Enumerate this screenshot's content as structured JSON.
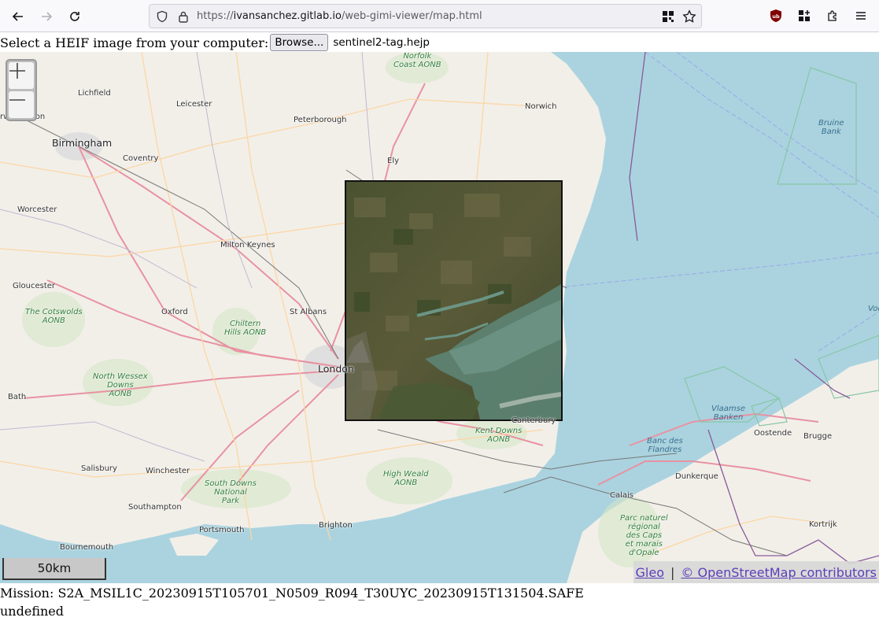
{
  "browser": {
    "url_prefix": "https://",
    "url_host": "ivansanchez.gitlab.io",
    "url_path": "/web-gimi-viewer/map.html",
    "icons": {
      "back": "back-arrow-icon",
      "forward": "forward-arrow-icon",
      "reload": "reload-icon",
      "shield": "tracking-protection-shield-icon",
      "lock": "lock-icon",
      "qr": "qr-code-icon",
      "bookmark": "star-icon",
      "ublock": "ublock-origin-icon",
      "extension_grid": "extensions-grid-icon",
      "extensions": "puzzle-icon",
      "menu": "hamburger-menu-icon"
    }
  },
  "file_input": {
    "label": "Select a HEIF image from your computer:",
    "button": "Browse...",
    "file_name": "sentinel2-tag.hejp"
  },
  "map": {
    "zoom_in": "+",
    "zoom_out": "—",
    "scale": "50km",
    "attribution": {
      "gleo": "Gleo",
      "separator": "|",
      "osm": "© OpenStreetMap contributors"
    },
    "places": [
      {
        "name": "Lichfield",
        "kind": "town"
      },
      {
        "name": "Leicester",
        "kind": "town"
      },
      {
        "name": "Peterborough",
        "kind": "town"
      },
      {
        "name": "Norwich",
        "kind": "town"
      },
      {
        "name": "Birmingham",
        "kind": "city"
      },
      {
        "name": "Coventry",
        "kind": "town"
      },
      {
        "name": "Ely",
        "kind": "town"
      },
      {
        "name": "Worcester",
        "kind": "town"
      },
      {
        "name": "Milton Keynes",
        "kind": "town"
      },
      {
        "name": "Gloucester",
        "kind": "town"
      },
      {
        "name": "Oxford",
        "kind": "town"
      },
      {
        "name": "St Albans",
        "kind": "town"
      },
      {
        "name": "Bath",
        "kind": "town"
      },
      {
        "name": "Salisbury",
        "kind": "town"
      },
      {
        "name": "Winchester",
        "kind": "town"
      },
      {
        "name": "Southampton",
        "kind": "town"
      },
      {
        "name": "Portsmouth",
        "kind": "town"
      },
      {
        "name": "Bournemouth",
        "kind": "town"
      },
      {
        "name": "Brighton",
        "kind": "town"
      },
      {
        "name": "Canterbury",
        "kind": "town"
      },
      {
        "name": "Calais",
        "kind": "town"
      },
      {
        "name": "Dunkerque",
        "kind": "town"
      },
      {
        "name": "Oostende",
        "kind": "town"
      },
      {
        "name": "Brugge",
        "kind": "town"
      },
      {
        "name": "Kortrijk",
        "kind": "town"
      },
      {
        "name": "London",
        "kind": "city"
      },
      {
        "name": "rwhampton",
        "kind": "town"
      }
    ],
    "areas": {
      "norfolk_coast": "Norfolk\nCoast AONB",
      "cotswolds": "The Cotswolds\nAONB",
      "chiltern": "Chiltern\nHills AONB",
      "north_wessex": "North Wessex\nDowns\nAONB",
      "south_downs": "South Downs\nNational\nPark",
      "high_weald": "High Weald\nAONB",
      "kent_downs": "Kent Downs\nAONB",
      "parc_naturel": "Parc naturel\nrégional\ndes Caps\net marais\nd'Opale"
    },
    "sea": {
      "bruine_bank": "Bruine\nBank",
      "vlaamse_banken": "Vlaamse\nBanken",
      "banc_des_flandres": "Banc des\nFlandres",
      "voo": "Voo"
    }
  },
  "info": {
    "mission": "Mission: S2A_MSIL1C_20230915T105701_N0509_R094_T30UYC_20230915T131504.SAFE",
    "extra": "undefined"
  }
}
